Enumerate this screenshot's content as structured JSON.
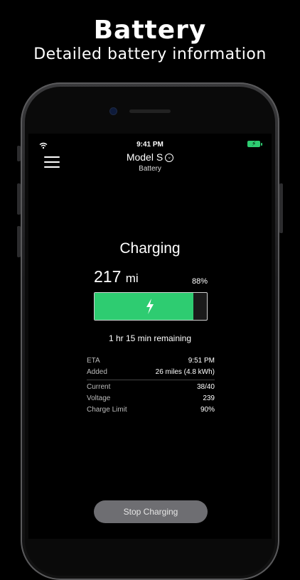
{
  "promo": {
    "title": "Battery",
    "subtitle": "Detailed battery information"
  },
  "status_bar": {
    "time": "9:41 PM",
    "wifi_icon": "wifi-icon",
    "battery_icon": "battery-charging-icon"
  },
  "nav": {
    "title": "Model S",
    "subtitle": "Battery",
    "menu_icon": "hamburger-menu-icon",
    "title_icon": "chevron-down-circle-icon"
  },
  "charging": {
    "status": "Charging",
    "range_value": "217",
    "range_unit": "mi",
    "percent": "88%",
    "fill_fraction": 0.88,
    "remaining": "1 hr 15 min remaining",
    "bar_color": "#2ecc71"
  },
  "stats": {
    "eta_label": "ETA",
    "eta_value": "9:51 PM",
    "added_label": "Added",
    "added_value": "26 miles (4.8 kWh)",
    "current_label": "Current",
    "current_value": "38/40",
    "voltage_label": "Voltage",
    "voltage_value": "239",
    "limit_label": "Charge Limit",
    "limit_value": "90%"
  },
  "actions": {
    "stop_label": "Stop Charging"
  }
}
